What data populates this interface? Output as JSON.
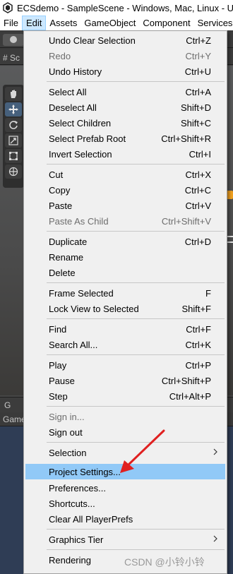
{
  "window": {
    "title": "ECSdemo - SampleScene - Windows, Mac, Linux - Unity"
  },
  "menubar": {
    "items": [
      {
        "label": "File",
        "active": false
      },
      {
        "label": "Edit",
        "active": true
      },
      {
        "label": "Assets",
        "active": false
      },
      {
        "label": "GameObject",
        "active": false
      },
      {
        "label": "Component",
        "active": false
      },
      {
        "label": "Services",
        "active": false
      }
    ]
  },
  "editor": {
    "scene_tab": "# Sc",
    "game_tab": "G",
    "game_label": "Game"
  },
  "edit_menu": {
    "items": [
      {
        "label": "Undo Clear Selection",
        "shortcut": "Ctrl+Z",
        "disabled": false
      },
      {
        "label": "Redo",
        "shortcut": "Ctrl+Y",
        "disabled": true
      },
      {
        "label": "Undo History",
        "shortcut": "Ctrl+U",
        "disabled": false
      },
      {
        "label": "Select All",
        "shortcut": "Ctrl+A",
        "disabled": false
      },
      {
        "label": "Deselect All",
        "shortcut": "Shift+D",
        "disabled": false
      },
      {
        "label": "Select Children",
        "shortcut": "Shift+C",
        "disabled": false
      },
      {
        "label": "Select Prefab Root",
        "shortcut": "Ctrl+Shift+R",
        "disabled": false
      },
      {
        "label": "Invert Selection",
        "shortcut": "Ctrl+I",
        "disabled": false
      },
      {
        "label": "Cut",
        "shortcut": "Ctrl+X",
        "disabled": false
      },
      {
        "label": "Copy",
        "shortcut": "Ctrl+C",
        "disabled": false
      },
      {
        "label": "Paste",
        "shortcut": "Ctrl+V",
        "disabled": false
      },
      {
        "label": "Paste As Child",
        "shortcut": "Ctrl+Shift+V",
        "disabled": true
      },
      {
        "label": "Duplicate",
        "shortcut": "Ctrl+D",
        "disabled": false
      },
      {
        "label": "Rename",
        "shortcut": "",
        "disabled": false
      },
      {
        "label": "Delete",
        "shortcut": "",
        "disabled": false
      },
      {
        "label": "Frame Selected",
        "shortcut": "F",
        "disabled": false
      },
      {
        "label": "Lock View to Selected",
        "shortcut": "Shift+F",
        "disabled": false
      },
      {
        "label": "Find",
        "shortcut": "Ctrl+F",
        "disabled": false
      },
      {
        "label": "Search All...",
        "shortcut": "Ctrl+K",
        "disabled": false
      },
      {
        "label": "Play",
        "shortcut": "Ctrl+P",
        "disabled": false
      },
      {
        "label": "Pause",
        "shortcut": "Ctrl+Shift+P",
        "disabled": false
      },
      {
        "label": "Step",
        "shortcut": "Ctrl+Alt+P",
        "disabled": false
      },
      {
        "label": "Sign in...",
        "shortcut": "",
        "disabled": true
      },
      {
        "label": "Sign out",
        "shortcut": "",
        "disabled": false
      },
      {
        "label": "Selection",
        "shortcut": "",
        "disabled": false,
        "submenu": true
      },
      {
        "label": "Project Settings...",
        "shortcut": "",
        "disabled": false,
        "highlighted": true
      },
      {
        "label": "Preferences...",
        "shortcut": "",
        "disabled": false
      },
      {
        "label": "Shortcuts...",
        "shortcut": "",
        "disabled": false
      },
      {
        "label": "Clear All PlayerPrefs",
        "shortcut": "",
        "disabled": false
      },
      {
        "label": "Graphics Tier",
        "shortcut": "",
        "disabled": false,
        "submenu": true
      },
      {
        "label": "Rendering",
        "shortcut": "",
        "disabled": false
      }
    ]
  },
  "watermark": "CSDN @小铃小铃",
  "colors": {
    "menu_bg": "#f0f0f0",
    "highlight": "#91c9f7",
    "disabled_text": "#6d6d6d",
    "annotation_arrow": "#e02020"
  },
  "icons": [
    "unity-logo-icon",
    "hand-tool-icon",
    "move-tool-icon",
    "rotate-tool-icon",
    "scale-tool-icon",
    "rect-tool-icon",
    "transform-tool-icon",
    "chevron-right-icon",
    "annotation-arrow-icon"
  ]
}
